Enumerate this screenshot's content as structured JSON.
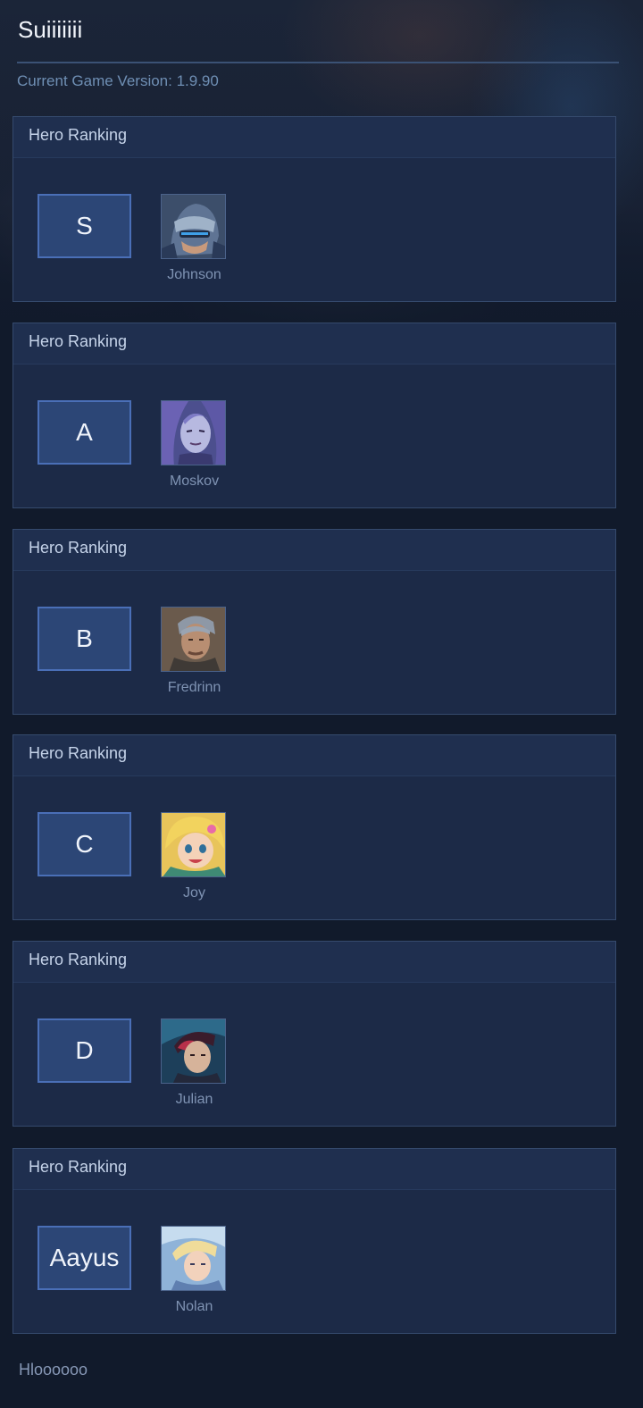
{
  "app": {
    "title": "Suiiiiiii",
    "version_text": "Current Game Version: 1.9.90"
  },
  "panels": [
    {
      "header": "Hero Ranking",
      "tier": "S",
      "hero": {
        "name": "Johnson",
        "icon": "johnson-portrait-icon"
      }
    },
    {
      "header": "Hero Ranking",
      "tier": "A",
      "hero": {
        "name": "Moskov",
        "icon": "moskov-portrait-icon"
      }
    },
    {
      "header": "Hero Ranking",
      "tier": "B",
      "hero": {
        "name": "Fredrinn",
        "icon": "fredrinn-portrait-icon"
      }
    },
    {
      "header": "Hero Ranking",
      "tier": "C",
      "hero": {
        "name": "Joy",
        "icon": "joy-portrait-icon"
      }
    },
    {
      "header": "Hero Ranking",
      "tier": "D",
      "hero": {
        "name": "Julian",
        "icon": "julian-portrait-icon"
      }
    },
    {
      "header": "Hero Ranking",
      "tier": "Aayus",
      "hero": {
        "name": "Nolan",
        "icon": "nolan-portrait-icon"
      }
    }
  ],
  "footer": {
    "text": "Hloooooo"
  },
  "colors": {
    "background": "#111a2b",
    "panel": "#1c2a47",
    "tier_box": "#2c4676",
    "tier_border": "#4a6fb7"
  }
}
